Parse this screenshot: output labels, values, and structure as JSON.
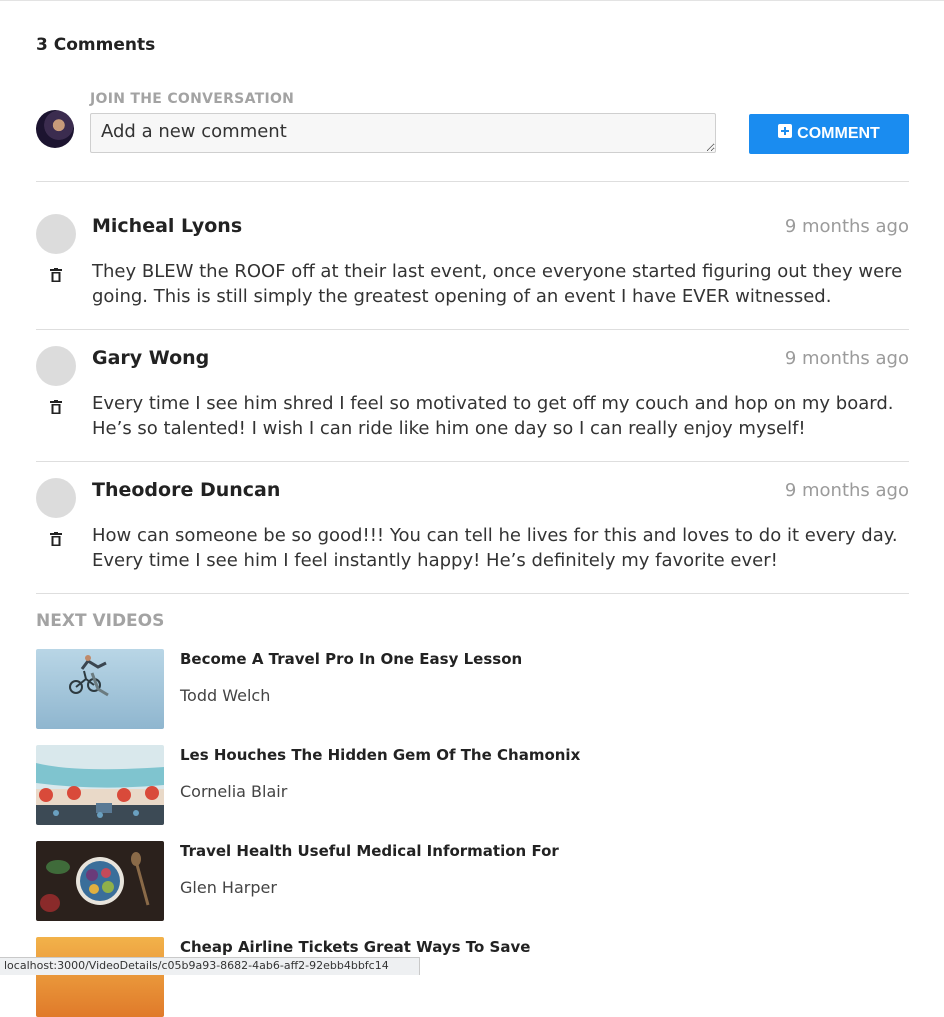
{
  "comments_header": {
    "count_label": "3 Comments"
  },
  "join": {
    "label": "JOIN THE CONVERSATION",
    "input_placeholder": "Add a new comment",
    "button_label": "COMMENT",
    "button_icon": "plus-square-icon",
    "accent_color": "#1a8cf0"
  },
  "comments": [
    {
      "name": "Micheal Lyons",
      "time": "9 months ago",
      "text": "They BLEW the ROOF off at their last event, once everyone started figuring out they were going. This is still simply the greatest opening of an event I have EVER witnessed."
    },
    {
      "name": "Gary Wong",
      "time": "9 months ago",
      "text": "Every time I see him shred I feel so motivated to get off my couch and hop on my board. He’s so talented! I wish I can ride like him one day so I can really enjoy myself!"
    },
    {
      "name": "Theodore Duncan",
      "time": "9 months ago",
      "text": "How can someone be so good!!! You can tell he lives for this and loves to do it every day. Every time I see him I feel instantly happy! He’s definitely my favorite ever!"
    }
  ],
  "next_videos": {
    "title": "NEXT VIDEOS",
    "items": [
      {
        "title": "Become A Travel Pro In One Easy Lesson",
        "author": "Todd Welch"
      },
      {
        "title": "Les Houches The Hidden Gem Of The Chamonix",
        "author": "Cornelia Blair"
      },
      {
        "title": "Travel Health Useful Medical Information For",
        "author": "Glen Harper"
      },
      {
        "title": "Cheap Airline Tickets Great Ways To Save",
        "author": ""
      }
    ]
  },
  "status_bar": {
    "url": "localhost:3000/VideoDetails/c05b9a93-8682-4ab6-aff2-92ebb4bbfc14"
  }
}
